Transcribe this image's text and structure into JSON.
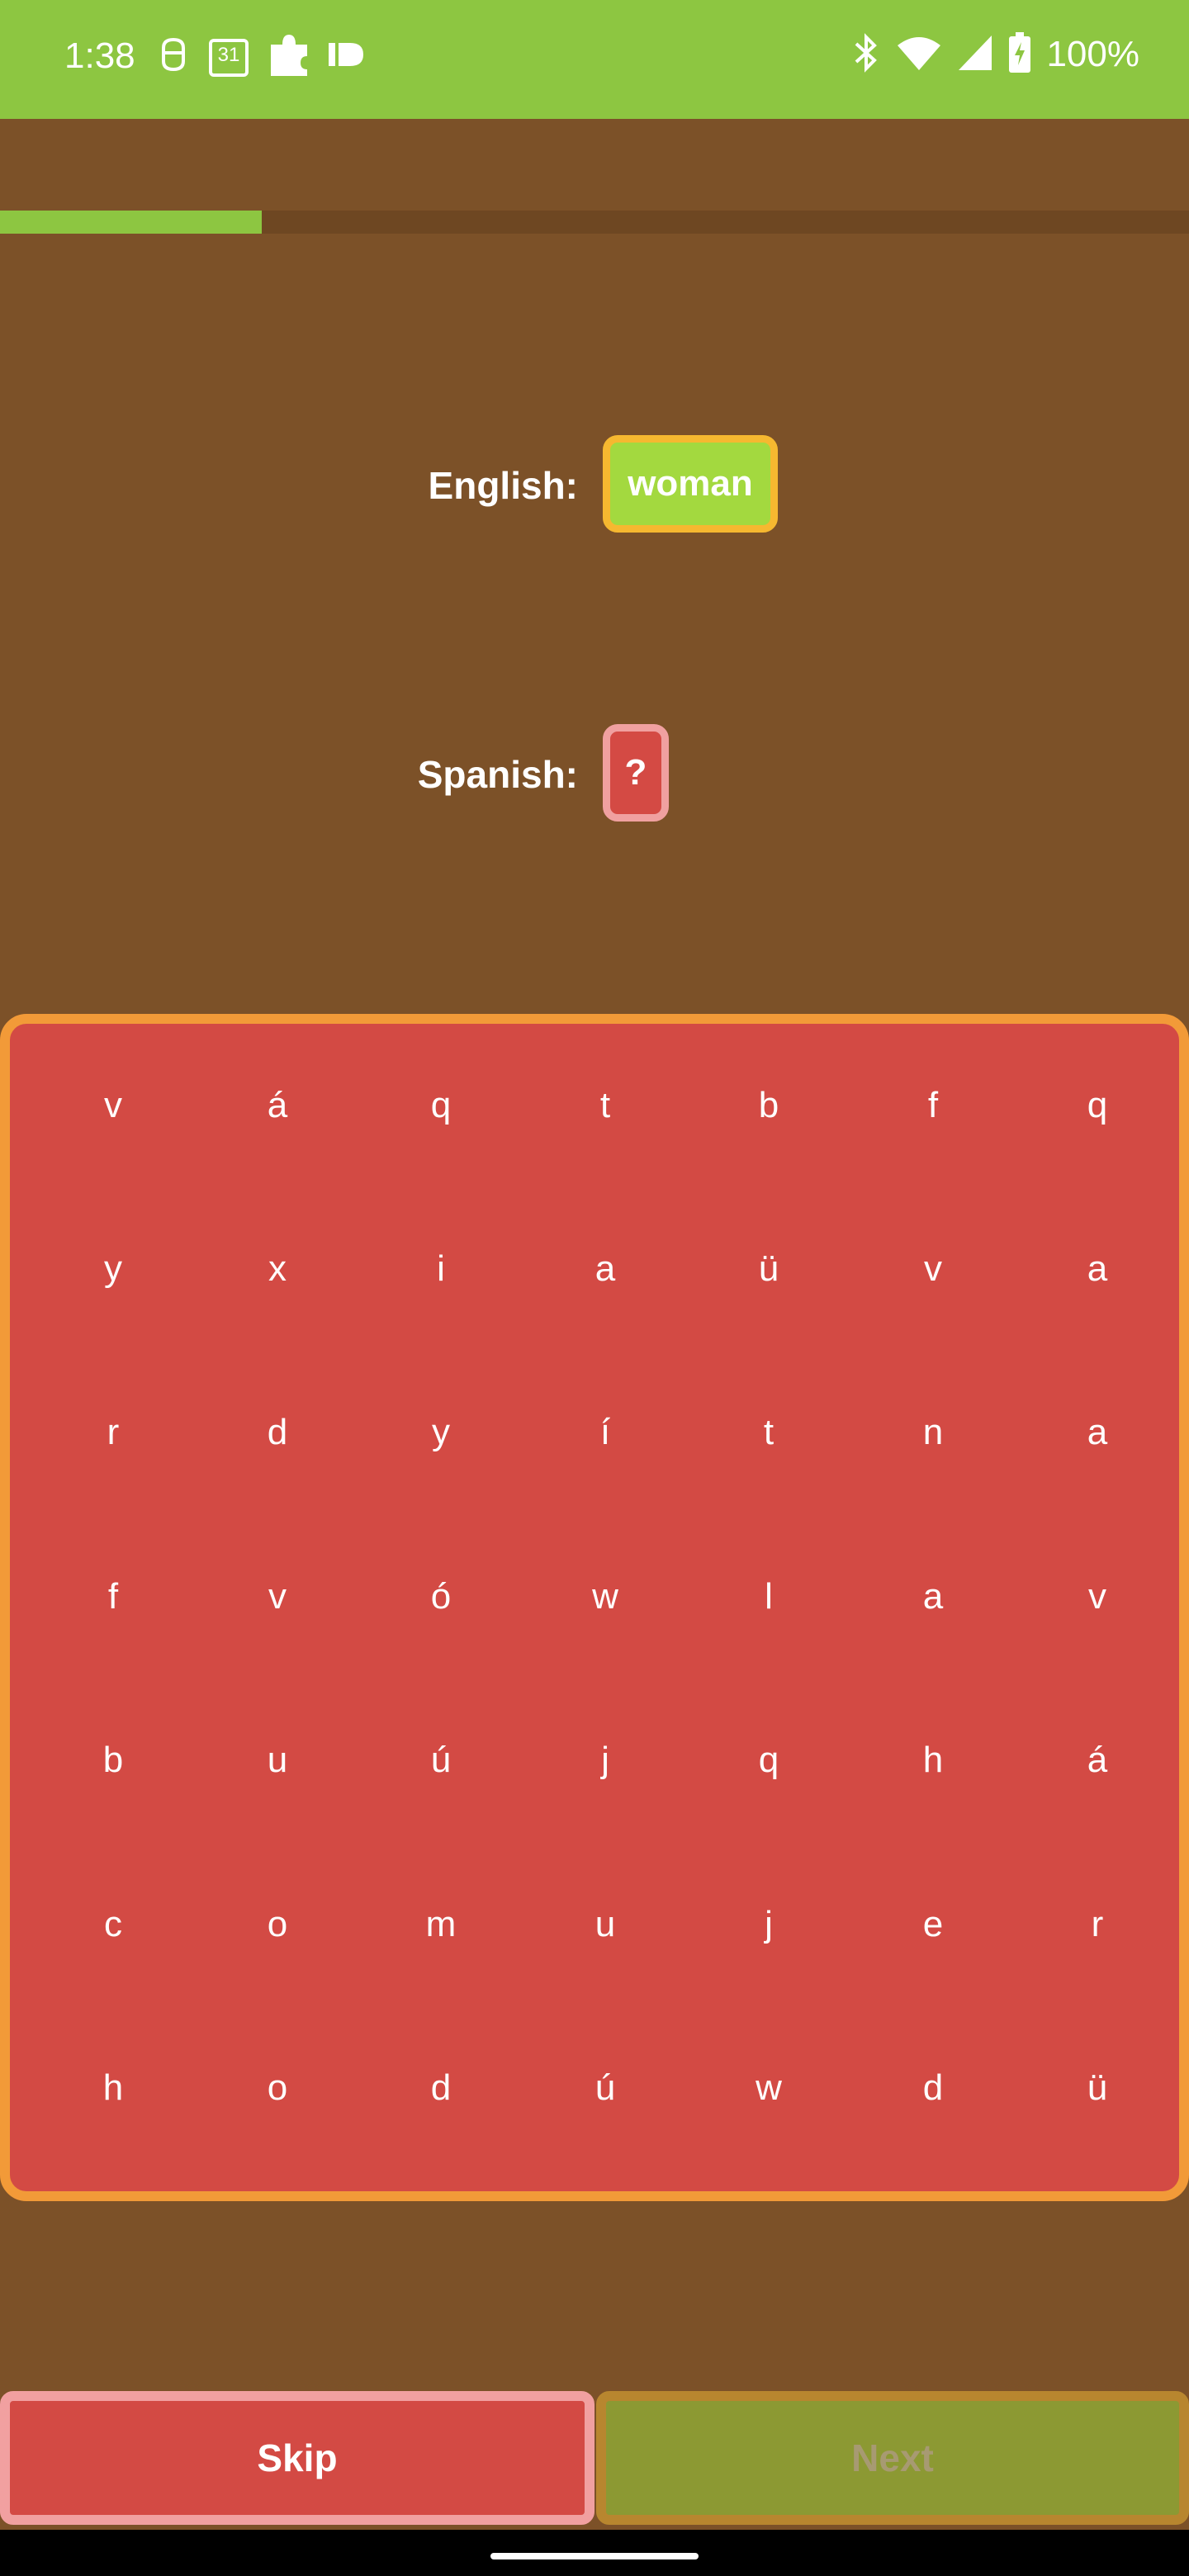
{
  "status": {
    "time": "1:38",
    "calendar_day": "31",
    "battery_pct": "100%"
  },
  "progress": {
    "fraction": 0.22,
    "fill_color": "#8dc641"
  },
  "prompt": {
    "english_label": "English:",
    "english_word": "woman",
    "spanish_label": "Spanish:",
    "spanish_answer": "?"
  },
  "grid": {
    "rows": [
      [
        "v",
        "á",
        "q",
        "t",
        "b",
        "f",
        "q"
      ],
      [
        "y",
        "x",
        "i",
        "a",
        "ü",
        "v",
        "a"
      ],
      [
        "r",
        "d",
        "y",
        "í",
        "t",
        "n",
        "a"
      ],
      [
        "f",
        "v",
        "ó",
        "w",
        "l",
        "a",
        "v"
      ],
      [
        "b",
        "u",
        "ú",
        "j",
        "q",
        "h",
        "á"
      ],
      [
        "c",
        "o",
        "m",
        "u",
        "j",
        "e",
        "r"
      ],
      [
        "h",
        "o",
        "d",
        "ú",
        "w",
        "d",
        "ü"
      ]
    ]
  },
  "buttons": {
    "skip": "Skip",
    "next": "Next"
  },
  "colors": {
    "background": "#7c5128",
    "accent_green": "#8dc641",
    "grid_red": "#d34a44",
    "grid_border": "#f29a38"
  }
}
